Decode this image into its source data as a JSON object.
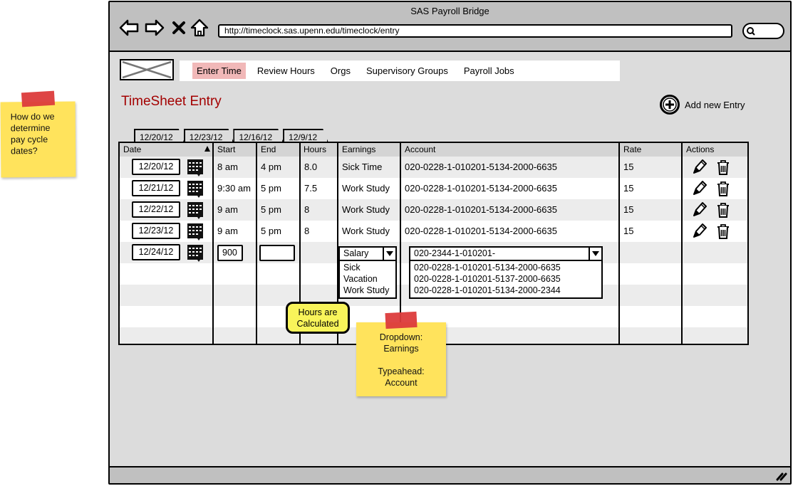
{
  "window": {
    "title": "SAS Payroll Bridge",
    "url": "http://timeclock.sas.upenn.edu/timeclock/entry",
    "search_value": ""
  },
  "nav": {
    "items": [
      {
        "label": "Enter Time",
        "active": true
      },
      {
        "label": "Review Hours",
        "active": false
      },
      {
        "label": "Orgs",
        "active": false
      },
      {
        "label": "Supervisory Groups",
        "active": false
      },
      {
        "label": "Payroll Jobs",
        "active": false
      }
    ],
    "active_color": "#f1b8b8"
  },
  "page": {
    "title": "TimeSheet Entry",
    "title_color": "#a30000",
    "add_entry_label": "Add new Entry"
  },
  "tabs": [
    "12/20/12",
    "12/23/12",
    "12/16/12",
    "12/9/12"
  ],
  "table": {
    "headers": [
      "Date",
      "Start",
      "End",
      "Hours",
      "Earnings",
      "Account",
      "Rate",
      "Actions"
    ],
    "rows": [
      {
        "date": "12/20/12",
        "start": "8 am",
        "end": "4 pm",
        "hours": "8.0",
        "earnings": "Sick Time",
        "account": "020-0228-1-010201-5134-2000-6635",
        "rate": "15"
      },
      {
        "date": "12/21/12",
        "start": "9:30 am",
        "end": "5 pm",
        "hours": "7.5",
        "earnings": "Work Study",
        "account": "020-0228-1-010201-5134-2000-6635",
        "rate": "15"
      },
      {
        "date": "12/22/12",
        "start": "9 am",
        "end": "5 pm",
        "hours": "8",
        "earnings": "Work Study",
        "account": "020-0228-1-010201-5134-2000-6635",
        "rate": "15"
      },
      {
        "date": "12/23/12",
        "start": "9 am",
        "end": "5 pm",
        "hours": "8",
        "earnings": "Work Study",
        "account": "020-0228-1-010201-5134-2000-6635",
        "rate": "15"
      }
    ],
    "new_row": {
      "date": "12/24/12",
      "start": "900",
      "end": "",
      "earnings_selected": "Salary",
      "earnings_options": [
        "Sick",
        "Vacation",
        "Work Study"
      ],
      "account_value": "020-2344-1-010201-",
      "account_suggestions": [
        "020-0228-1-010201-5134-2000-6635",
        "020-0228-1-010201-5137-2000-6635",
        "020-0228-1-010201-5134-2000-2344"
      ]
    }
  },
  "notes": {
    "pay_cycle": "How do we determine pay cycle dates?",
    "hours_callout": "Hours are Calculated",
    "dropdown_note_line1": "Dropdown:",
    "dropdown_note_line2": "Earnings",
    "dropdown_note_line3": "Typeahead:",
    "dropdown_note_line4": "Account"
  }
}
